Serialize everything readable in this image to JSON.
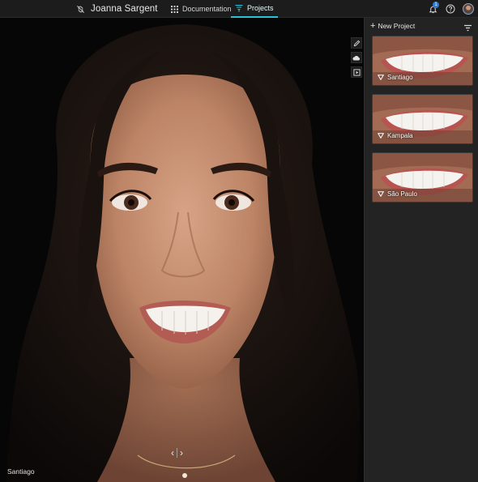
{
  "header": {
    "patient_name": "Joanna Sargent",
    "tabs": [
      {
        "label": "Documentation",
        "icon": "grid-icon",
        "active": false
      },
      {
        "label": "Projects",
        "icon": "projects-icon",
        "active": true
      }
    ],
    "notification_count": "1",
    "accent_color": "#29c3d8"
  },
  "viewer": {
    "caption": "Santiago",
    "pager": {
      "prev": "‹",
      "next": "›"
    },
    "tools": [
      "pencil-icon",
      "cloud-icon",
      "export-icon"
    ]
  },
  "sidebar": {
    "new_project_label": "New Project",
    "projects": [
      {
        "name": "Santiago"
      },
      {
        "name": "Kampala"
      },
      {
        "name": "São Paulo"
      }
    ]
  }
}
